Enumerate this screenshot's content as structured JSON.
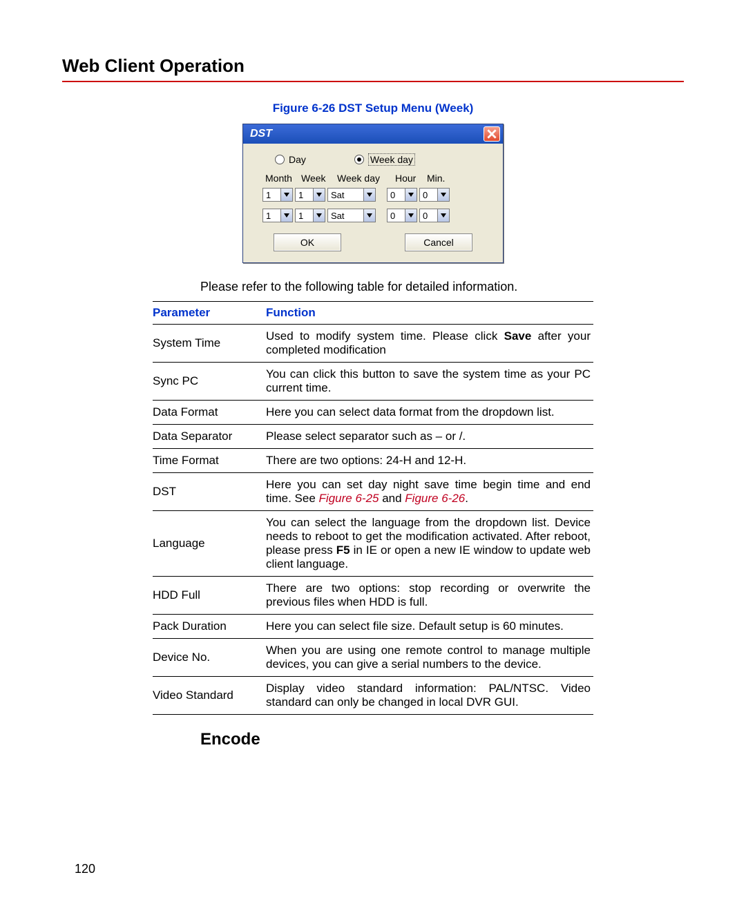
{
  "page": {
    "title": "Web Client Operation",
    "number": "120",
    "figure_caption": "Figure 6-26 DST Setup Menu (Week)",
    "intro_text": "Please refer to the following table for detailed information.",
    "subhead": "Encode"
  },
  "dialog": {
    "title": "DST",
    "radio_day": "Day",
    "radio_week": "Week day",
    "headers": {
      "month": "Month",
      "week": "Week",
      "weekday": "Week day",
      "hour": "Hour",
      "min": "Min."
    },
    "row1": {
      "month": "1",
      "week": "1",
      "weekday": "Sat",
      "hour": "0",
      "min": "0"
    },
    "row2": {
      "month": "1",
      "week": "1",
      "weekday": "Sat",
      "hour": "0",
      "min": "0"
    },
    "ok": "OK",
    "cancel": "Cancel"
  },
  "table": {
    "head_param": "Parameter",
    "head_func": "Function",
    "rows": [
      {
        "param": "System Time",
        "func_pre": "Used to modify system time. Please click ",
        "func_bold": "Save",
        "func_post": " after your completed modification"
      },
      {
        "param": "Sync PC",
        "func": "You can click this button to save the system time as your PC current time."
      },
      {
        "param": "Data Format",
        "func": "Here you can select data format from the dropdown list."
      },
      {
        "param": "Data Separator",
        "func": "Please select separator such as – or /."
      },
      {
        "param": "Time Format",
        "func": "There are two options: 24-H and 12-H."
      },
      {
        "param": "DST",
        "func_pre": "Here you can set day night save time begin time and end time. See ",
        "ref1": "Figure 6-25",
        "mid": " and ",
        "ref2": "Figure 6-26",
        "post": "."
      },
      {
        "param": "Language",
        "func_pre": "You can select the language from the dropdown list. Device needs to reboot to get the modification activated. After reboot, please press ",
        "func_bold": "F5",
        "func_post": " in IE or open a new IE window to update web client language."
      },
      {
        "param": "HDD Full",
        "func": "There are two options: stop recording or overwrite the previous files when HDD is full."
      },
      {
        "param": "Pack Duration",
        "func": "Here you can select file size. Default setup is 60 minutes."
      },
      {
        "param": "Device No.",
        "func": "When you are using one remote control to manage multiple devices, you can give a serial numbers to the device."
      },
      {
        "param": "Video Standard",
        "func": "Display video standard information: PAL/NTSC. Video standard can only be changed in local DVR GUI."
      }
    ]
  }
}
